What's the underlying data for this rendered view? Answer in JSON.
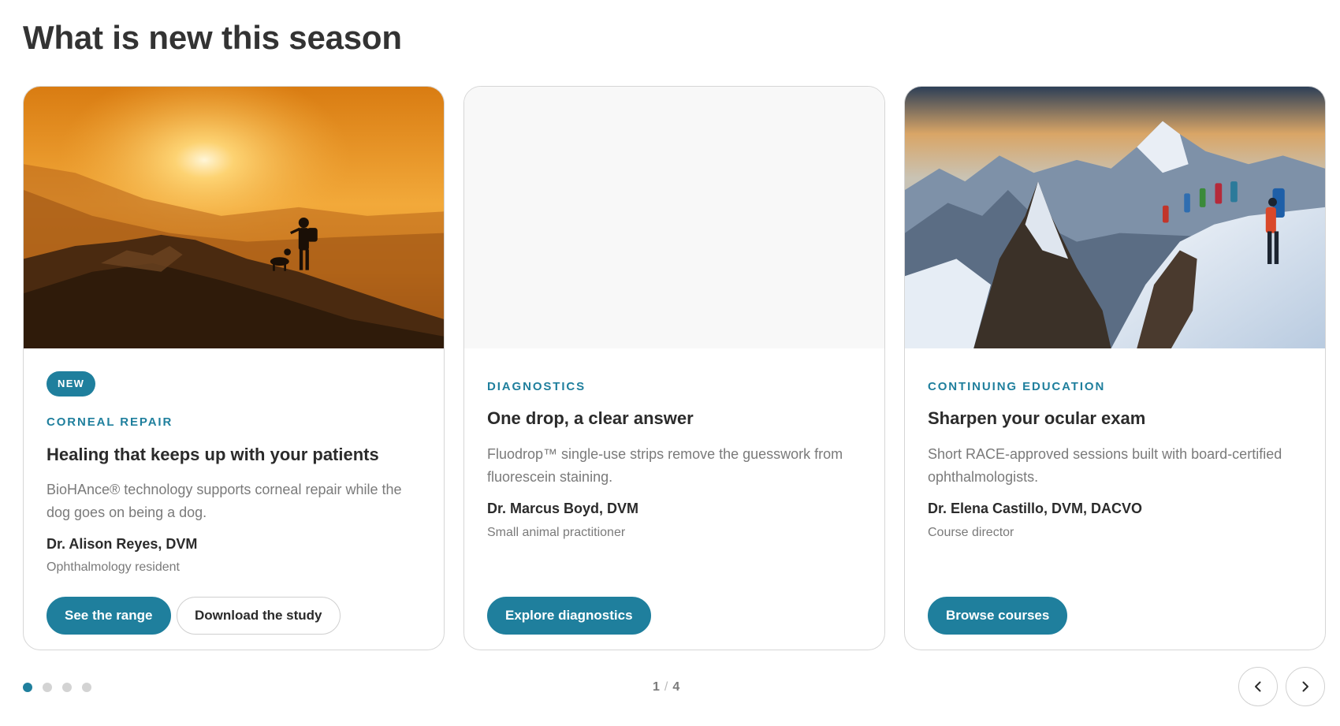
{
  "page": {
    "heading": "What is new this season"
  },
  "cards": [
    {
      "badge": "NEW",
      "eyebrow": "CORNEAL REPAIR",
      "title": "Healing that keeps up with your patients",
      "description": "BioHAnce® technology supports corneal repair while the dog goes on being a dog.",
      "author": "Dr. Alison Reyes, DVM",
      "role": "Ophthalmology resident",
      "image": "hiker-with-dog-on-mountain-at-sunset",
      "buttons": {
        "primary": "See the range",
        "secondary": "Download the study"
      }
    },
    {
      "eyebrow": "DIAGNOSTICS",
      "title": "One drop, a clear answer",
      "description": "Fluodrop™ single-use strips remove the guesswork from fluorescein staining.",
      "author": "Dr. Marcus Boyd, DVM",
      "role": "Small animal practitioner",
      "image": "blank-placeholder",
      "buttons": {
        "primary": "Explore diagnostics"
      }
    },
    {
      "eyebrow": "CONTINUING EDUCATION",
      "title": "Sharpen your ocular exam",
      "description": "Short RACE-approved sessions built with board-certified ophthalmologists.",
      "author": "Dr. Elena Castillo, DVM, DACVO",
      "role": "Course director",
      "image": "climbers-on-snowy-mountain-ridge",
      "buttons": {
        "primary": "Browse courses"
      }
    }
  ],
  "pagination": {
    "current": "1",
    "total": "4",
    "separator": "/",
    "dots": 4,
    "active_index": 0
  },
  "nav": {
    "prev_icon": "chevron-left-icon",
    "next_icon": "chevron-right-icon"
  },
  "colors": {
    "accent": "#1f7f9d",
    "text": "#2b2b2b",
    "muted": "#7a7a7a",
    "border": "#d6d6d6",
    "dot_inactive": "#d3d3d3"
  }
}
